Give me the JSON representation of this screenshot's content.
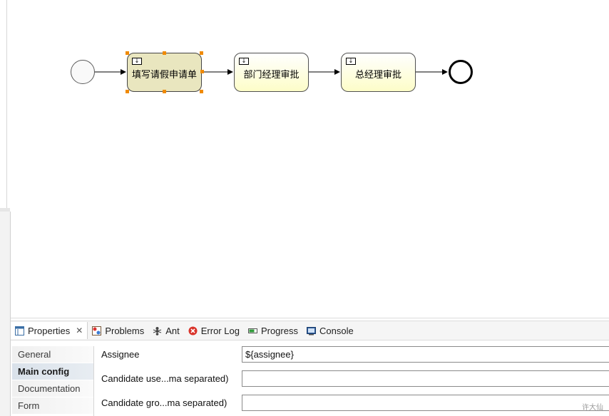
{
  "diagram": {
    "tasks": [
      {
        "label": "填写请假申请单",
        "selected": true
      },
      {
        "label": "部门经理审批",
        "selected": false
      },
      {
        "label": "总经理审批",
        "selected": false
      }
    ]
  },
  "tabs": [
    {
      "label": "Properties",
      "icon": "properties-icon",
      "active": true,
      "closable": true
    },
    {
      "label": "Problems",
      "icon": "problems-icon",
      "active": false
    },
    {
      "label": "Ant",
      "icon": "ant-icon",
      "active": false
    },
    {
      "label": "Error Log",
      "icon": "error-log-icon",
      "active": false
    },
    {
      "label": "Progress",
      "icon": "progress-icon",
      "active": false
    },
    {
      "label": "Console",
      "icon": "console-icon",
      "active": false
    }
  ],
  "close_glyph": "✕",
  "sidebar": {
    "items": [
      {
        "label": "General",
        "active": false
      },
      {
        "label": "Main config",
        "active": true
      },
      {
        "label": "Documentation",
        "active": false
      },
      {
        "label": "Form",
        "active": false
      }
    ]
  },
  "form": {
    "assignee_label": "Assignee",
    "assignee_value": "${assignee}",
    "candidate_users_label": "Candidate use...ma separated)",
    "candidate_users_value": "",
    "candidate_groups_label": "Candidate gro...ma separated)",
    "candidate_groups_value": ""
  },
  "watermark": "许大仙",
  "colors": {
    "selection_handle": "#f08a00",
    "task_fill": "#fdfdc8",
    "selected_task_fill": "#e9e6bf"
  }
}
